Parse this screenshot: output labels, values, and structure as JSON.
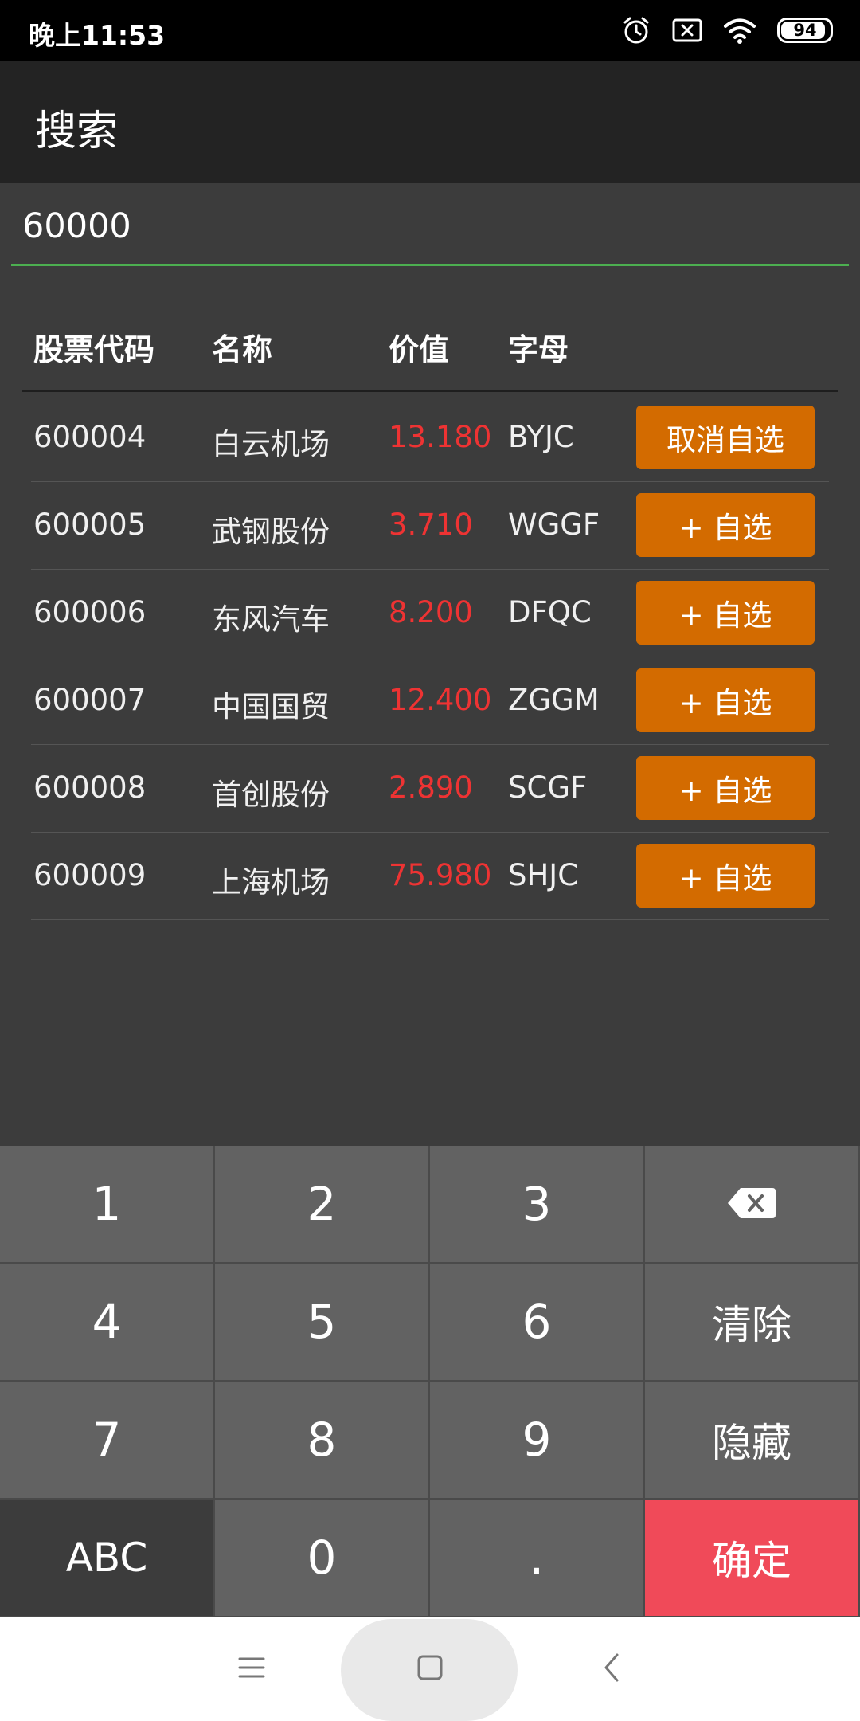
{
  "status_bar": {
    "time": "晚上11:53",
    "battery": "94",
    "icons": [
      "alarm-icon",
      "sim-error-icon",
      "wifi-icon",
      "battery-icon"
    ]
  },
  "header": {
    "title": "搜索"
  },
  "search": {
    "value": "60000",
    "underline_color": "#4caf50"
  },
  "table": {
    "headers": [
      "股票代码",
      "名称",
      "价值",
      "字母"
    ],
    "rows": [
      {
        "code": "600004",
        "name": "白云机场",
        "price": "13.180",
        "letters": "BYJC",
        "action": "取消自选"
      },
      {
        "code": "600005",
        "name": "武钢股份",
        "price": "3.710",
        "letters": "WGGF",
        "action": "+ 自选"
      },
      {
        "code": "600006",
        "name": "东风汽车",
        "price": "8.200",
        "letters": "DFQC",
        "action": "+ 自选"
      },
      {
        "code": "600007",
        "name": "中国国贸",
        "price": "12.400",
        "letters": "ZGGM",
        "action": "+ 自选"
      },
      {
        "code": "600008",
        "name": "首创股份",
        "price": "2.890",
        "letters": "SCGF",
        "action": "+ 自选"
      },
      {
        "code": "600009",
        "name": "上海机场",
        "price": "75.980",
        "letters": "SHJC",
        "action": "+ 自选"
      }
    ]
  },
  "keyboard": {
    "row1": [
      "1",
      "2",
      "3"
    ],
    "row2": [
      "4",
      "5",
      "6"
    ],
    "row3": [
      "7",
      "8",
      "9"
    ],
    "abc": "ABC",
    "zero": "0",
    "dot": ".",
    "clear": "清除",
    "hide": "隐藏",
    "confirm": "确定",
    "backspace_icon": "backspace-icon"
  },
  "colors": {
    "accent_button": "#d36b00",
    "price_red": "#ee3333",
    "confirm_key": "#f04a59"
  },
  "nav": {
    "icons": [
      "menu-icon",
      "home-icon",
      "back-icon"
    ]
  }
}
